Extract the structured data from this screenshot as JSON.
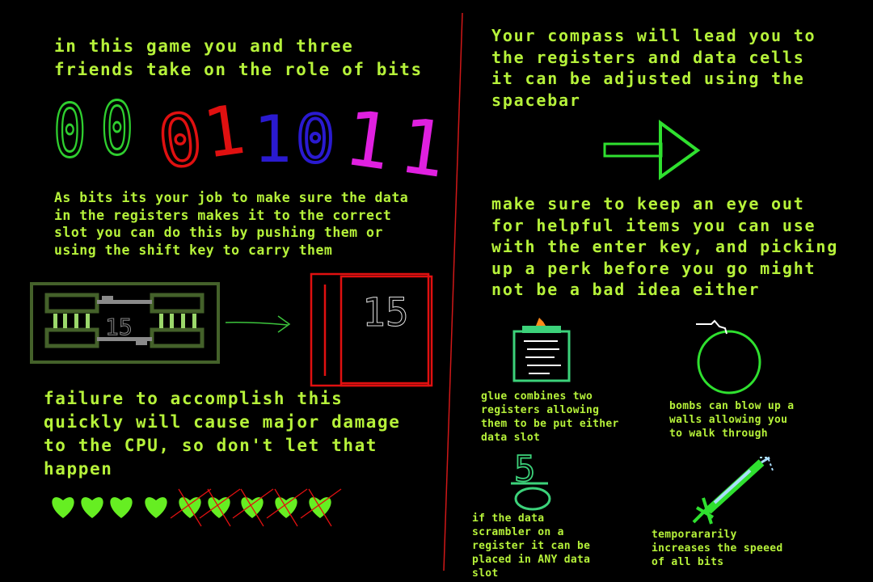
{
  "left_panel": {
    "intro_text": "in this game you and three\nfriends take on the role of bits",
    "bits": [
      "0",
      "0",
      "0",
      "1",
      "1",
      "0",
      "1",
      "1"
    ],
    "job_text": "As bits its your job to make sure the data\nin the registers makes it to the correct\nslot you can do this by pushing them or\nusing the shift key to carry them",
    "register_value": "15",
    "slot_value": "15",
    "failure_text": "failure to accomplish this\nquickly will cause major damage\nto the CPU, so don't let that\nhappen",
    "lives": {
      "total": 9,
      "lost": 5
    }
  },
  "right_panel": {
    "compass_text": "Your compass will lead you to\nthe registers and data cells\nit can be adjusted using the\nspacebar",
    "items_text": "make sure to keep an eye out\nfor helpful items you can use\nwith the enter key, and picking\nup a perk before you go might\nnot be a bad idea either",
    "glue_text": "glue combines two\nregisters allowing\nthem to be put either\ndata slot",
    "bomb_text": "bombs can blow up a\nwalls allowing you\nto walk through",
    "scrambler_value": "5",
    "scrambler_text": "if the data\nscrambler on a\nregister it can be\nplaced in ANY data\nslot",
    "speed_text": "temporararily\nincreases the speeed\nof all bits"
  },
  "colors": {
    "text": "#b6f23a",
    "bit_green": "#2fcf2f",
    "bit_red": "#e01010",
    "bit_blue": "#2a1ad0",
    "bit_magenta": "#e020e0",
    "divider": "#d01818",
    "heart": "#66ee22",
    "register_frame": "#44612a"
  }
}
